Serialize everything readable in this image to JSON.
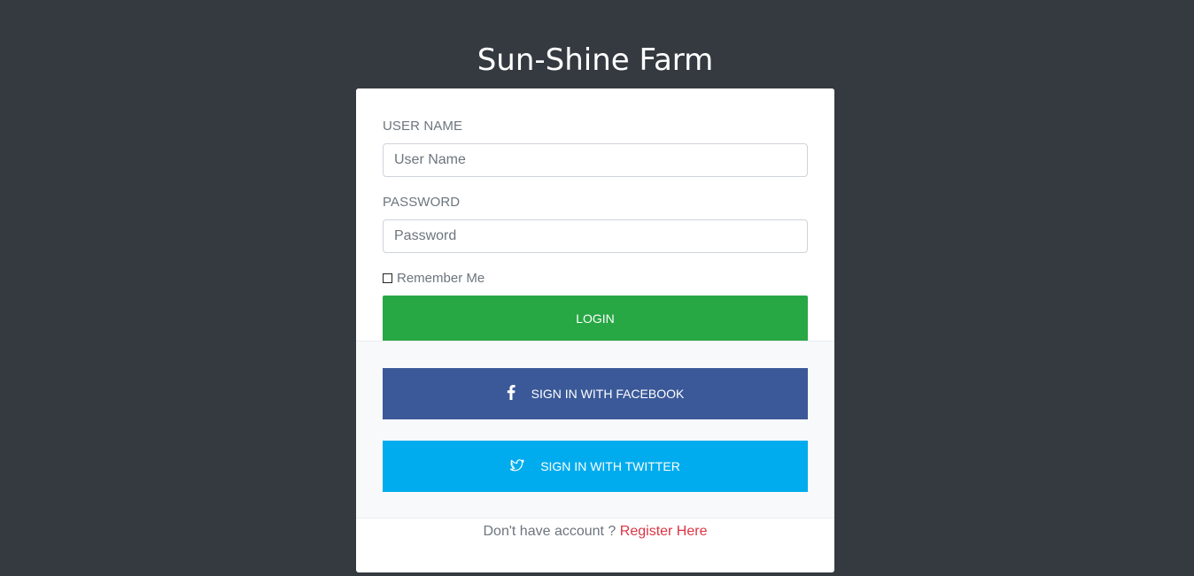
{
  "app": {
    "title": "Sun-Shine Farm"
  },
  "form": {
    "username_label": "USER NAME",
    "username_placeholder": "User Name",
    "username_value": "",
    "password_label": "PASSWORD",
    "password_placeholder": "Password",
    "password_value": "",
    "remember_label": "Remember Me",
    "remember_checked": false,
    "login_label": "LOGIN"
  },
  "social": {
    "facebook_label": "SIGN IN WITH FACEBOOK",
    "facebook_icon": "facebook-icon",
    "twitter_label": "SIGN IN WITH TWITTER",
    "twitter_icon": "twitter-icon"
  },
  "footer": {
    "prompt": "Don't have account ?",
    "register_label": "Register Here"
  },
  "colors": {
    "background": "#343a40",
    "login": "#28a745",
    "facebook": "#3b5998",
    "twitter": "#00acee",
    "register_link": "#dc3545"
  }
}
